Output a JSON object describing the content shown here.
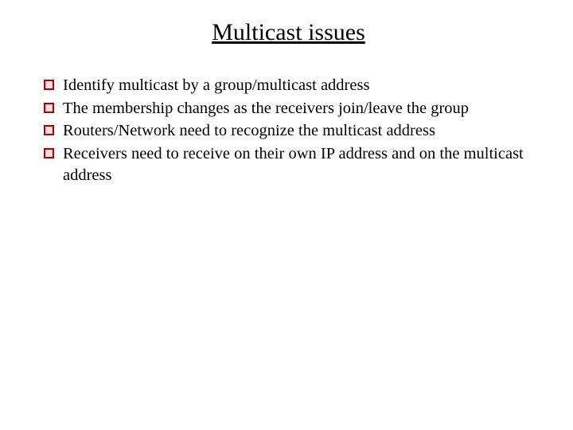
{
  "title": "Multicast issues",
  "bullets": [
    "Identify multicast by a group/multicast address",
    "The membership changes as the receivers join/leave the group",
    "Routers/Network need to recognize the multicast address",
    "Receivers need to receive on their own IP address and on the multicast address"
  ]
}
